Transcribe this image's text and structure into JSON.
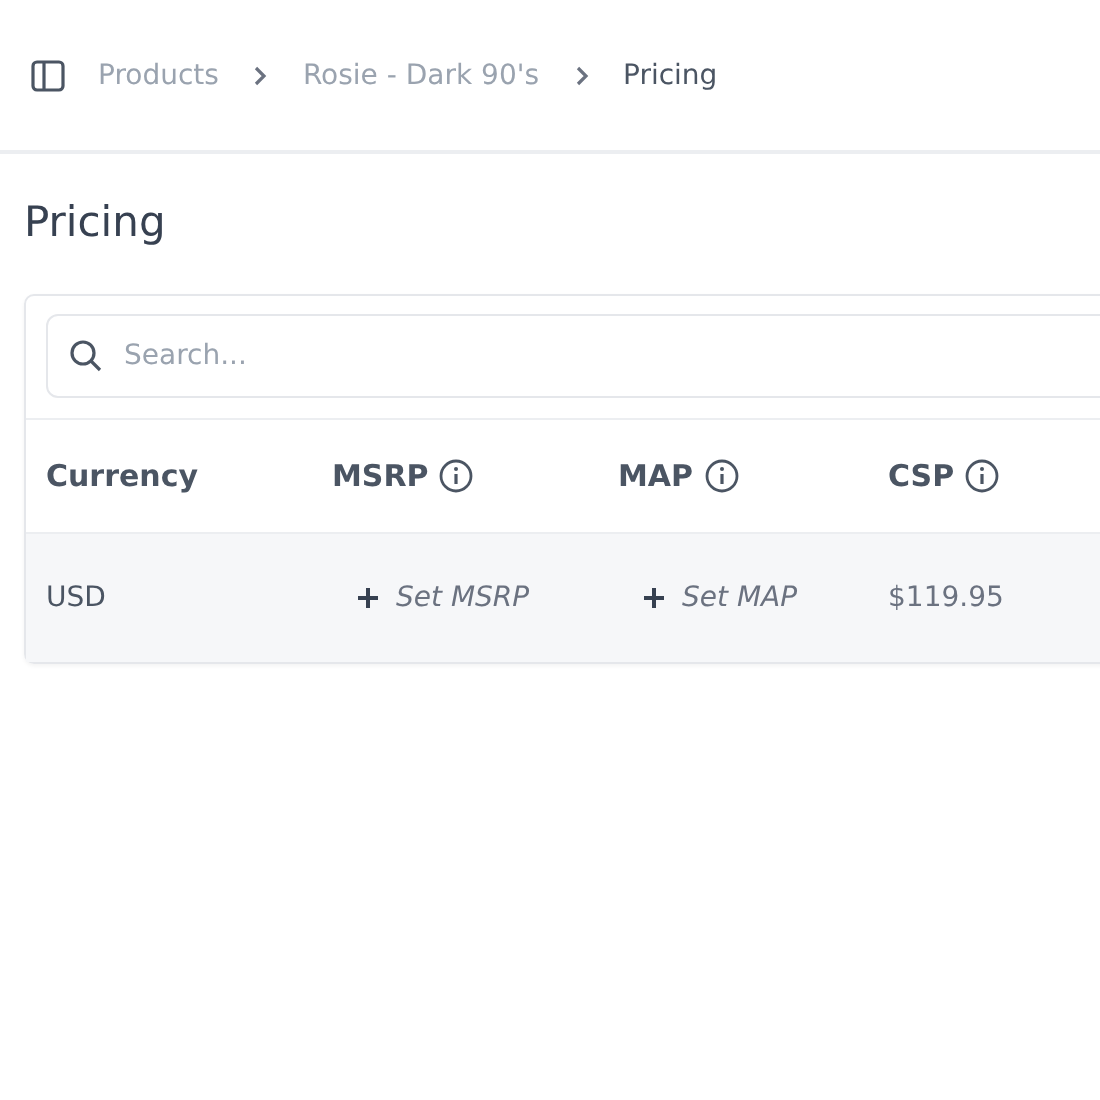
{
  "breadcrumbs": [
    {
      "label": "Products",
      "current": false
    },
    {
      "label": "Rosie - Dark 90's",
      "current": false
    },
    {
      "label": "Pricing",
      "current": true
    }
  ],
  "page_title": "Pricing",
  "search": {
    "placeholder": "Search..."
  },
  "table": {
    "columns": [
      {
        "label": "Currency",
        "info": false
      },
      {
        "label": "MSRP",
        "info": true
      },
      {
        "label": "MAP",
        "info": true
      },
      {
        "label": "CSP",
        "info": true
      }
    ],
    "rows": [
      [
        {
          "kind": "text",
          "text": "USD"
        },
        {
          "kind": "action",
          "text": "Set MSRP"
        },
        {
          "kind": "action",
          "text": "Set MAP"
        },
        {
          "kind": "text",
          "text": "$119.95"
        }
      ]
    ]
  }
}
